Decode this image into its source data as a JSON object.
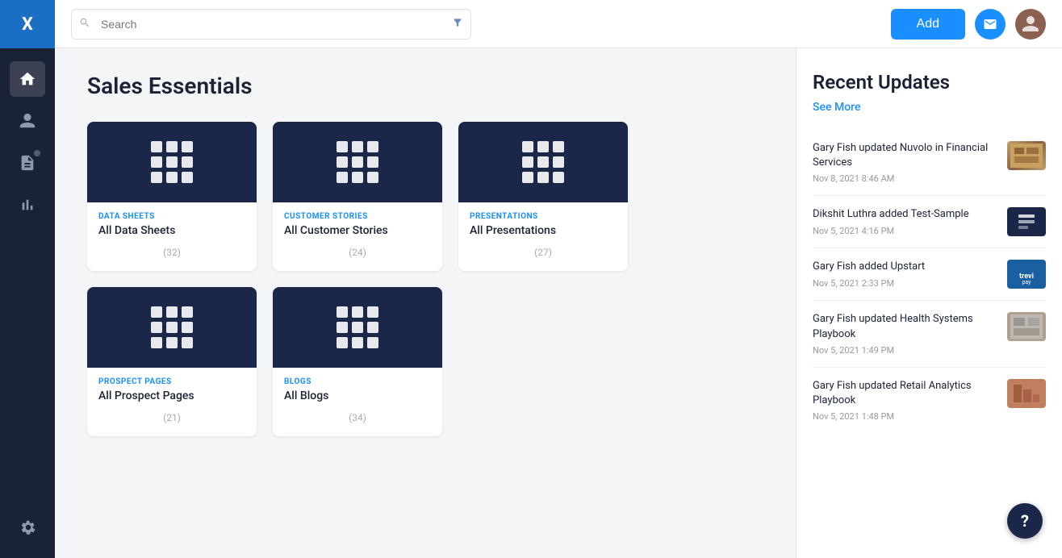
{
  "app": {
    "logo": "X",
    "title": "Sales Essentials"
  },
  "topbar": {
    "search_placeholder": "Search",
    "add_label": "Add"
  },
  "sidebar": {
    "items": [
      {
        "name": "home",
        "icon": "⌂",
        "active": true
      },
      {
        "name": "people",
        "icon": "👤",
        "active": false
      },
      {
        "name": "documents",
        "icon": "📋",
        "active": false
      },
      {
        "name": "analytics",
        "icon": "📊",
        "active": false
      },
      {
        "name": "settings",
        "icon": "⚙",
        "active": false
      }
    ]
  },
  "cards": [
    {
      "category": "DATA SHEETS",
      "title": "All Data Sheets",
      "count": "(32)"
    },
    {
      "category": "CUSTOMER STORIES",
      "title": "All Customer Stories",
      "count": "(24)"
    },
    {
      "category": "PRESENTATIONS",
      "title": "All Presentations",
      "count": "(27)"
    },
    {
      "category": "PROSPECT PAGES",
      "title": "All Prospect Pages",
      "count": "(21)"
    },
    {
      "category": "BLOGS",
      "title": "All Blogs",
      "count": "(34)"
    }
  ],
  "right_panel": {
    "title": "Recent Updates",
    "see_more": "See More",
    "updates": [
      {
        "desc": "Gary Fish updated Nuvolo in Financial Services",
        "time": "Nov 8, 2021 8:46 AM",
        "thumb_type": "nuvolo"
      },
      {
        "desc": "Dikshit Luthra added Test-Sample",
        "time": "Nov 5, 2021 4:16 PM",
        "thumb_type": "test"
      },
      {
        "desc": "Gary Fish added Upstart",
        "time": "Nov 5, 2021 2:33 PM",
        "thumb_type": "upstart"
      },
      {
        "desc": "Gary Fish updated Health Systems Playbook",
        "time": "Nov 5, 2021 1:49 PM",
        "thumb_type": "health"
      },
      {
        "desc": "Gary Fish updated Retail Analytics Playbook",
        "time": "Nov 5, 2021 1:48 PM",
        "thumb_type": "retail"
      }
    ]
  }
}
